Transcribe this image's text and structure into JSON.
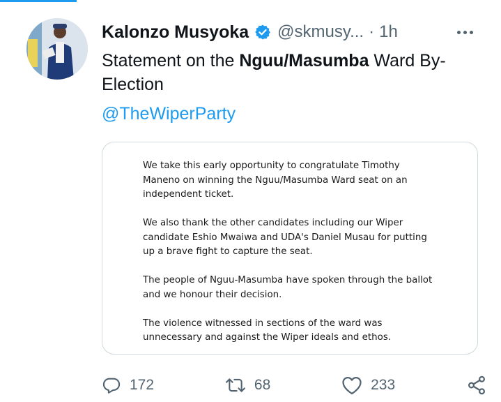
{
  "tweet": {
    "author_name": "Kalonzo Musyoka",
    "handle": "@skmusy...",
    "separator": "·",
    "time": "1h",
    "text_prefix": "Statement on the ",
    "text_bold": "Nguu/Masumba",
    "text_suffix": " Ward By-Election",
    "mention": "@TheWiperParty"
  },
  "statement_image": {
    "paragraphs": [
      " We take this early opportunity to congratulate Timothy Maneno on winning the Nguu/Masumba Ward seat on an independent ticket.",
      "We also thank the other candidates including our Wiper candidate Eshio Mwaiwa and UDA's  Daniel Musau for putting up a brave fight to capture the seat.",
      "The people of Nguu-Masumba have spoken through the ballot and we honour their decision.",
      "The violence witnessed in sections of the ward was unnecessary and against the Wiper ideals and ethos."
    ]
  },
  "actions": {
    "reply_count": "172",
    "retweet_count": "68",
    "like_count": "233"
  },
  "icons": {
    "verified": "verified-badge-icon",
    "more": "more-dots-icon",
    "reply": "reply-icon",
    "retweet": "retweet-icon",
    "like": "heart-icon",
    "share": "share-icon"
  },
  "colors": {
    "accent": "#1d9bf0",
    "text": "#0f1419",
    "secondary": "#536471",
    "border": "#cfd9de"
  }
}
